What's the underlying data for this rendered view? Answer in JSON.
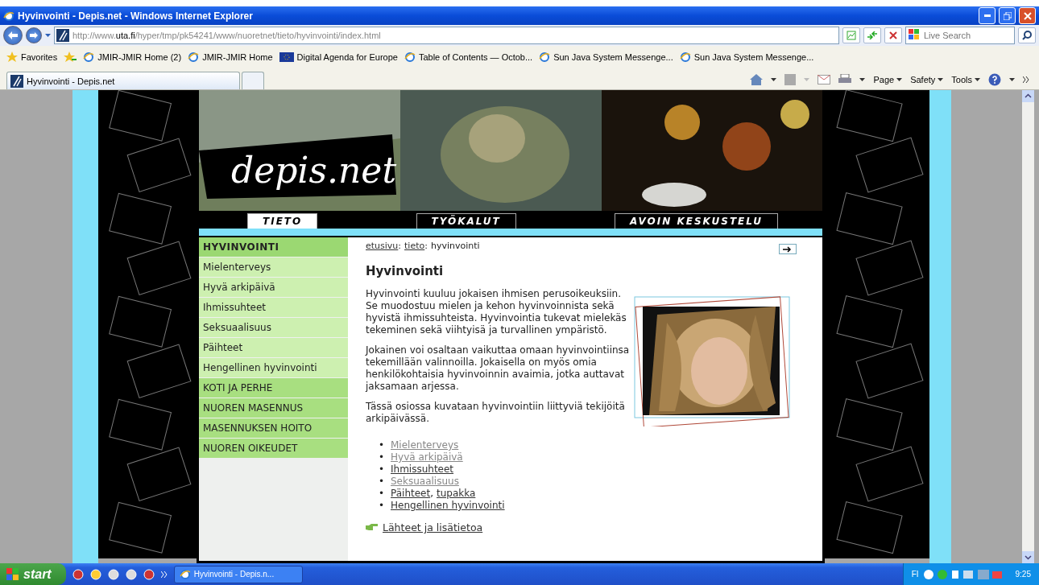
{
  "window": {
    "title": "Hyvinvointi - Depis.net - Windows Internet Explorer"
  },
  "address_bar": {
    "url_prefix": "http://www.",
    "url_domain": "uta.fi",
    "url_path": "/hyper/tmp/pk54241/www/nuoretnet/tieto/hyvinvointi/index.html"
  },
  "search": {
    "placeholder": "Live Search"
  },
  "favorites_bar": {
    "label": "Favorites",
    "items": [
      {
        "label": "JMIR-JMIR Home (2)",
        "kind": "page"
      },
      {
        "label": "JMIR-JMIR Home",
        "kind": "page"
      },
      {
        "label": "Digital Agenda for Europe",
        "kind": "flag"
      },
      {
        "label": "Table of Contents — Octob...",
        "kind": "page"
      },
      {
        "label": "Sun Java System Messenge...",
        "kind": "page"
      },
      {
        "label": "Sun Java System Messenge...",
        "kind": "page"
      }
    ]
  },
  "tabs": [
    {
      "label": "Hyvinvointi - Depis.net",
      "selected": true
    }
  ],
  "command_bar": [
    "Page",
    "Safety",
    "Tools"
  ],
  "site": {
    "logo": "depis.net",
    "nav_tabs": [
      {
        "label": "TIETO",
        "selected": true
      },
      {
        "label": "TYÖKALUT",
        "selected": false
      },
      {
        "label": "AVOIN KESKUSTELU",
        "selected": false
      }
    ],
    "sidebar": [
      {
        "label": "HYVINVOINTI",
        "kind": "section",
        "selected": true
      },
      {
        "label": "Mielenterveys",
        "kind": "sub",
        "selected": false
      },
      {
        "label": "Hyvä arkipäivä",
        "kind": "sub",
        "selected": false
      },
      {
        "label": "Ihmissuhteet",
        "kind": "sub",
        "selected": false
      },
      {
        "label": "Seksuaalisuus",
        "kind": "sub",
        "selected": false
      },
      {
        "label": "Päihteet",
        "kind": "sub",
        "selected": false
      },
      {
        "label": "Hengellinen hyvinvointi",
        "kind": "sub",
        "selected": false
      },
      {
        "label": "KOTI JA PERHE",
        "kind": "section",
        "selected": false
      },
      {
        "label": "NUOREN MASENNUS",
        "kind": "section",
        "selected": false
      },
      {
        "label": "MASENNUKSEN HOITO",
        "kind": "section",
        "selected": false
      },
      {
        "label": "NUOREN OIKEUDET",
        "kind": "section",
        "selected": false
      }
    ],
    "breadcrumb": {
      "separator": ":",
      "items": [
        {
          "label": "etusivu",
          "kind": "link"
        },
        {
          "label": "tieto",
          "kind": "link"
        },
        {
          "label": "hyvinvointi",
          "kind": "current"
        }
      ]
    },
    "heading": "Hyvinvointi",
    "paragraphs": [
      "Hyvinvointi kuuluu jokaisen ihmisen perusoikeuksiin. Se muodostuu mielen ja kehon hyvinvoinnista sekä hyvistä ihmissuhteista. Hyvinvointia tukevat mielekäs tekeminen sekä viihtyisä ja turvallinen ympäristö.",
      "Jokainen voi osaltaan vaikuttaa omaan hyvinvointiinsa tekemillään valinnoilla. Jokaisella on myös omia henkilökohtaisia hyvinvoinnin avaimia, jotka auttavat jaksamaan arjessa.",
      "Tässä osiossa kuvataan hyvinvointiin liittyviä tekijöitä arkipäivässä."
    ],
    "topic_links": [
      {
        "bullet": "•",
        "links": [
          {
            "label": "Mielenterveys",
            "visited": true
          }
        ]
      },
      {
        "bullet": "•",
        "links": [
          {
            "label": "Hyvä arkipäivä",
            "visited": true
          }
        ]
      },
      {
        "bullet": "•",
        "links": [
          {
            "label": "Ihmissuhteet",
            "visited": false
          }
        ]
      },
      {
        "bullet": "•",
        "links": [
          {
            "label": "Seksuaalisuus",
            "visited": true
          }
        ]
      },
      {
        "bullet": "•",
        "separator": ",",
        "links": [
          {
            "label": "Päihteet",
            "visited": false
          },
          {
            "label": "tupakka",
            "visited": false
          }
        ]
      },
      {
        "bullet": "•",
        "links": [
          {
            "label": "Hengellinen hyvinvointi",
            "visited": false
          }
        ]
      }
    ],
    "footer_link": "Lähteet ja lisätietoa"
  },
  "taskbar": {
    "start": "start",
    "tasks": [
      {
        "label": "Hyvinvointi - Depis.n...",
        "selected": false
      }
    ],
    "language": "FI",
    "clock": "9:25"
  }
}
